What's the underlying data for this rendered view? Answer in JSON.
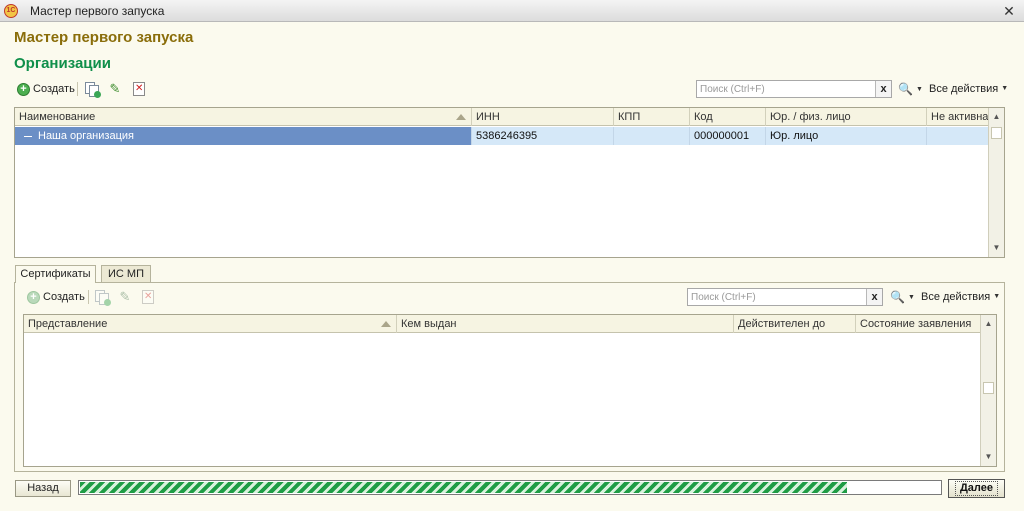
{
  "window": {
    "title": "Мастер первого запуска",
    "app_icon": "1c-logo-icon"
  },
  "heading": "Мастер первого запуска",
  "section_title": "Организации",
  "org_toolbar": {
    "create_label": "Создать",
    "search_placeholder": "Поиск (Ctrl+F)",
    "search_clear": "x",
    "all_actions": "Все действия"
  },
  "org_table": {
    "columns": [
      "Наименование",
      "ИНН",
      "КПП",
      "Код",
      "Юр. / физ. лицо",
      "Не активна"
    ],
    "rows": [
      {
        "name": "Наша организация",
        "inn": "5386246395",
        "kpp": "",
        "code": "000000001",
        "type": "Юр. лицо",
        "inactive": ""
      }
    ]
  },
  "tabs": [
    {
      "label": "Сертификаты",
      "active": true
    },
    {
      "label": "ИС МП",
      "active": false
    }
  ],
  "cert_toolbar": {
    "create_label": "Создать",
    "search_placeholder": "Поиск (Ctrl+F)",
    "search_clear": "x",
    "all_actions": "Все действия"
  },
  "cert_table": {
    "columns": [
      "Представление",
      "Кем выдан",
      "Действителен до",
      "Состояние заявления"
    ],
    "rows": []
  },
  "footer": {
    "back_label": "Назад",
    "next_label": "Далее",
    "progress": 0.89
  },
  "colors": {
    "heading": "#8a6d0a",
    "section_title": "#0f8f4a",
    "selected_row": "#d5e8f8",
    "focused_cell": "#6b8fc6",
    "progress": "#1f9c45"
  }
}
